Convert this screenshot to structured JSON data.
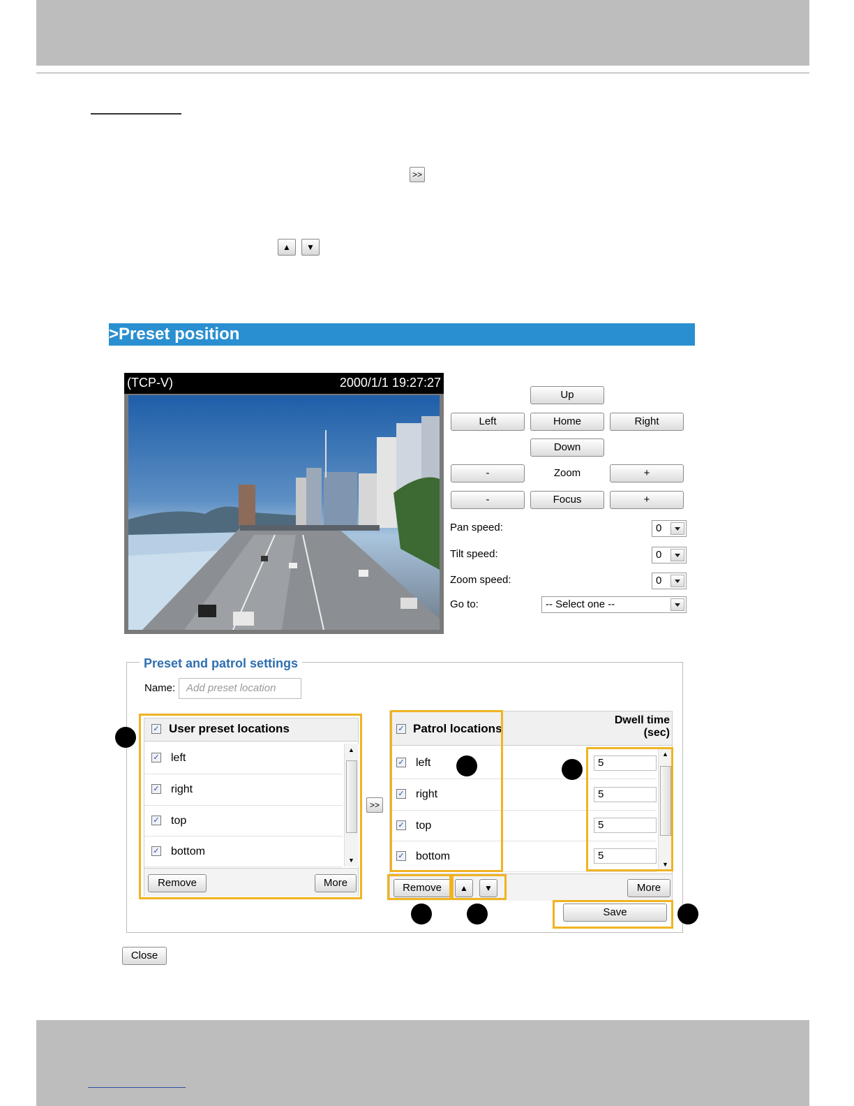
{
  "page": {
    "inline_buttons": {
      "add_icon_label": ">>",
      "up_arrow": "▲",
      "down_arrow": "▼"
    }
  },
  "banner": {
    "title": ">Preset position"
  },
  "video": {
    "protocol": "(TCP-V)",
    "timestamp": "2000/1/1 19:27:27"
  },
  "controls": {
    "up": "Up",
    "left": "Left",
    "home": "Home",
    "right": "Right",
    "down": "Down",
    "zoom_minus": "-",
    "zoom_label": "Zoom",
    "zoom_plus": "+",
    "focus_minus": "-",
    "focus_label": "Focus",
    "focus_plus": "+",
    "pan_speed_label": "Pan speed:",
    "pan_speed_value": "0",
    "tilt_speed_label": "Tilt speed:",
    "tilt_speed_value": "0",
    "zoom_speed_label": "Zoom speed:",
    "zoom_speed_value": "0",
    "goto_label": "Go to:",
    "goto_value": "-- Select one --"
  },
  "preset_settings": {
    "legend": "Preset and patrol settings",
    "name_label": "Name:",
    "name_placeholder": "Add preset location",
    "user_list": {
      "header": "User preset locations",
      "items": [
        "left",
        "right",
        "top",
        "bottom"
      ],
      "remove": "Remove",
      "more": "More"
    },
    "add_button": ">>",
    "patrol_list": {
      "header": "Patrol locations",
      "dwell_header_1": "Dwell time",
      "dwell_header_2": "(sec)",
      "items": [
        "left",
        "right",
        "top",
        "bottom"
      ],
      "dwell_values": [
        "5",
        "5",
        "5",
        "5"
      ],
      "remove": "Remove",
      "up": "▲",
      "down": "▼",
      "more": "More"
    },
    "save": "Save"
  },
  "close": "Close",
  "colors": {
    "banner": "#2a8fd0",
    "highlight": "#f0b322",
    "legend": "#2f6fb0"
  }
}
